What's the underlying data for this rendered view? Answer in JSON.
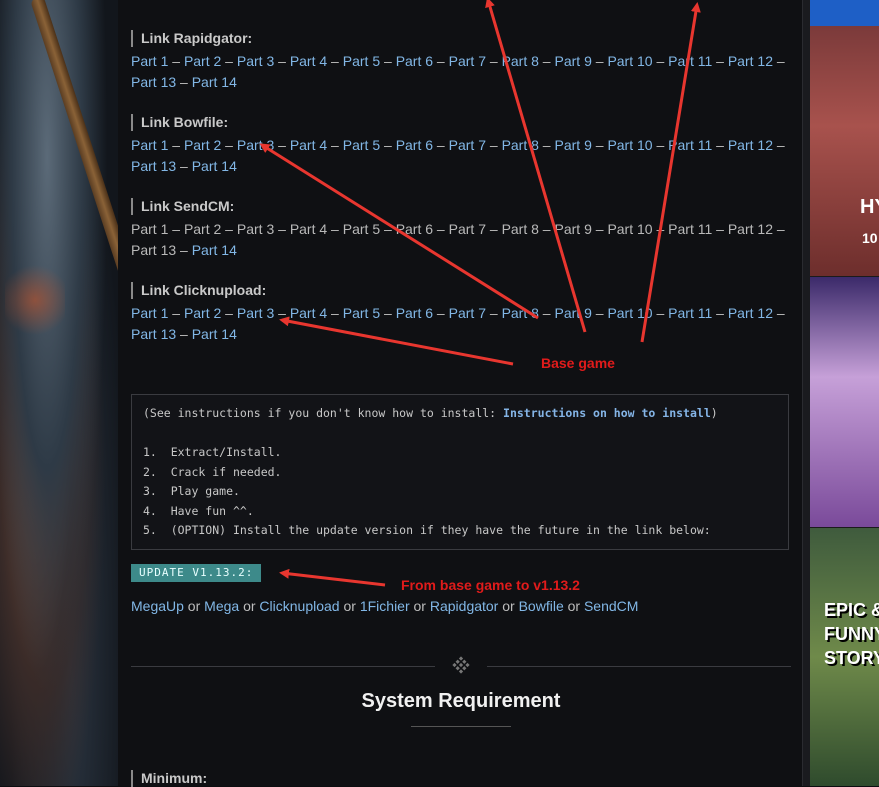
{
  "sections": [
    {
      "title": "Link Rapidgator:",
      "parts": [
        "Part 1",
        "Part 2",
        "Part 3",
        "Part 4",
        "Part 5",
        "Part 6",
        "Part 7",
        "Part 8",
        "Part 9",
        "Part 10",
        "Part 11",
        "Part 12",
        "Part 13",
        "Part 14"
      ],
      "link_style": "blue"
    },
    {
      "title": "Link Bowfile:",
      "parts": [
        "Part 1",
        "Part 2",
        "Part 3",
        "Part 4",
        "Part 5",
        "Part 6",
        "Part 7",
        "Part 8",
        "Part 9",
        "Part 10",
        "Part 11",
        "Part 12",
        "Part 13",
        "Part 14"
      ],
      "link_style": "blue"
    },
    {
      "title": "Link SendCM:",
      "parts": [
        "Part 1",
        "Part 2",
        "Part 3",
        "Part 4",
        "Part 5",
        "Part 6",
        "Part 7",
        "Part 8",
        "Part 9",
        "Part 10",
        "Part 11",
        "Part 12",
        "Part 13",
        "Part 14"
      ],
      "link_style": "grey"
    },
    {
      "title": "Link Clicknupload:",
      "parts": [
        "Part 1",
        "Part 2",
        "Part 3",
        "Part 4",
        "Part 5",
        "Part 6",
        "Part 7",
        "Part 8",
        "Part 9",
        "Part 10",
        "Part 11",
        "Part 12",
        "Part 13",
        "Part 14"
      ],
      "link_style": "blue"
    }
  ],
  "separator": " – ",
  "instructions": {
    "intro_prefix": "(See instructions if you don't know how to install: ",
    "intro_link": "Instructions on how to install",
    "intro_suffix": ")",
    "steps": [
      "1.  Extract/Install.",
      "2.  Crack if needed.",
      "3.  Play game.",
      "4.  Have fun ^^.",
      "5.  (OPTION) Install the update version if they have the future in the link below:"
    ]
  },
  "update": {
    "badge": "UPDATE V1.13.2:",
    "mirrors": [
      "MegaUp",
      "Mega",
      "Clicknupload",
      "1Fichier",
      "Rapidgator",
      "Bowfile",
      "SendCM"
    ],
    "joiner": " or "
  },
  "system_requirement": {
    "title": "System Requirement",
    "minimum": "Minimum:"
  },
  "annotations": {
    "base_game": "Base game",
    "update_note": "From base game to v1.13.2",
    "color": "#e01b1b"
  },
  "ads": {
    "hy": "HY",
    "ten": "10",
    "epic_lines": [
      "EPIC &",
      "FUNNY",
      "STORY"
    ]
  },
  "colors": {
    "link": "#82b7e6",
    "badge": "#3d8a8a",
    "background": "#0f1013"
  }
}
